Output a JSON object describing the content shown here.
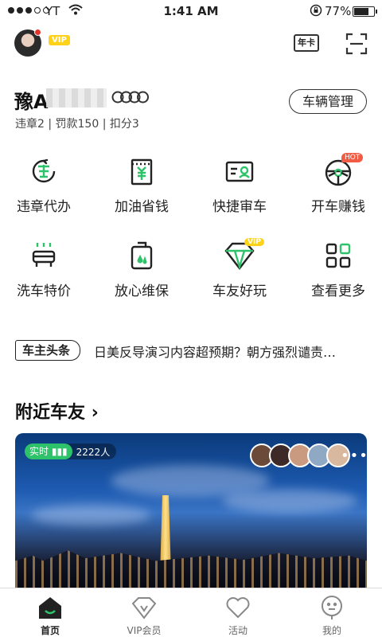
{
  "status_bar": {
    "carrier": "YT",
    "time": "1:41 AM",
    "battery": "77%",
    "battery_level": 0.77
  },
  "header": {
    "vip_badge": "VIP",
    "card_label": "年卡"
  },
  "vehicle": {
    "plate_prefix": "豫A",
    "manage_button": "车辆管理",
    "summary": "违章2 | 罚款150 | 扣分3"
  },
  "grid": [
    {
      "label": "违章代办",
      "icon": "violation-icon"
    },
    {
      "label": "加油省钱",
      "icon": "fuel-icon"
    },
    {
      "label": "快捷审车",
      "icon": "inspection-icon"
    },
    {
      "label": "开车赚钱",
      "icon": "steering-wheel-icon",
      "badge": "HOT"
    },
    {
      "label": "洗车特价",
      "icon": "car-wash-icon"
    },
    {
      "label": "放心维保",
      "icon": "maintenance-icon"
    },
    {
      "label": "车友好玩",
      "icon": "diamond-icon",
      "badge": "VIP"
    },
    {
      "label": "查看更多",
      "icon": "more-grid-icon"
    }
  ],
  "news": {
    "tag": "车主头条",
    "headline": "日美反导演习内容超预期？朝方强烈谴责…"
  },
  "nearby": {
    "title": "附近车友",
    "live_label": "实时",
    "count": "2222人"
  },
  "tabbar": [
    {
      "label": "首页",
      "active": true
    },
    {
      "label": "VIP会员"
    },
    {
      "label": "活动"
    },
    {
      "label": "我的"
    }
  ],
  "colors": {
    "accent_green": "#2ec26a",
    "vip_yellow": "#ffd21a",
    "hot_red": "#f25b44"
  }
}
